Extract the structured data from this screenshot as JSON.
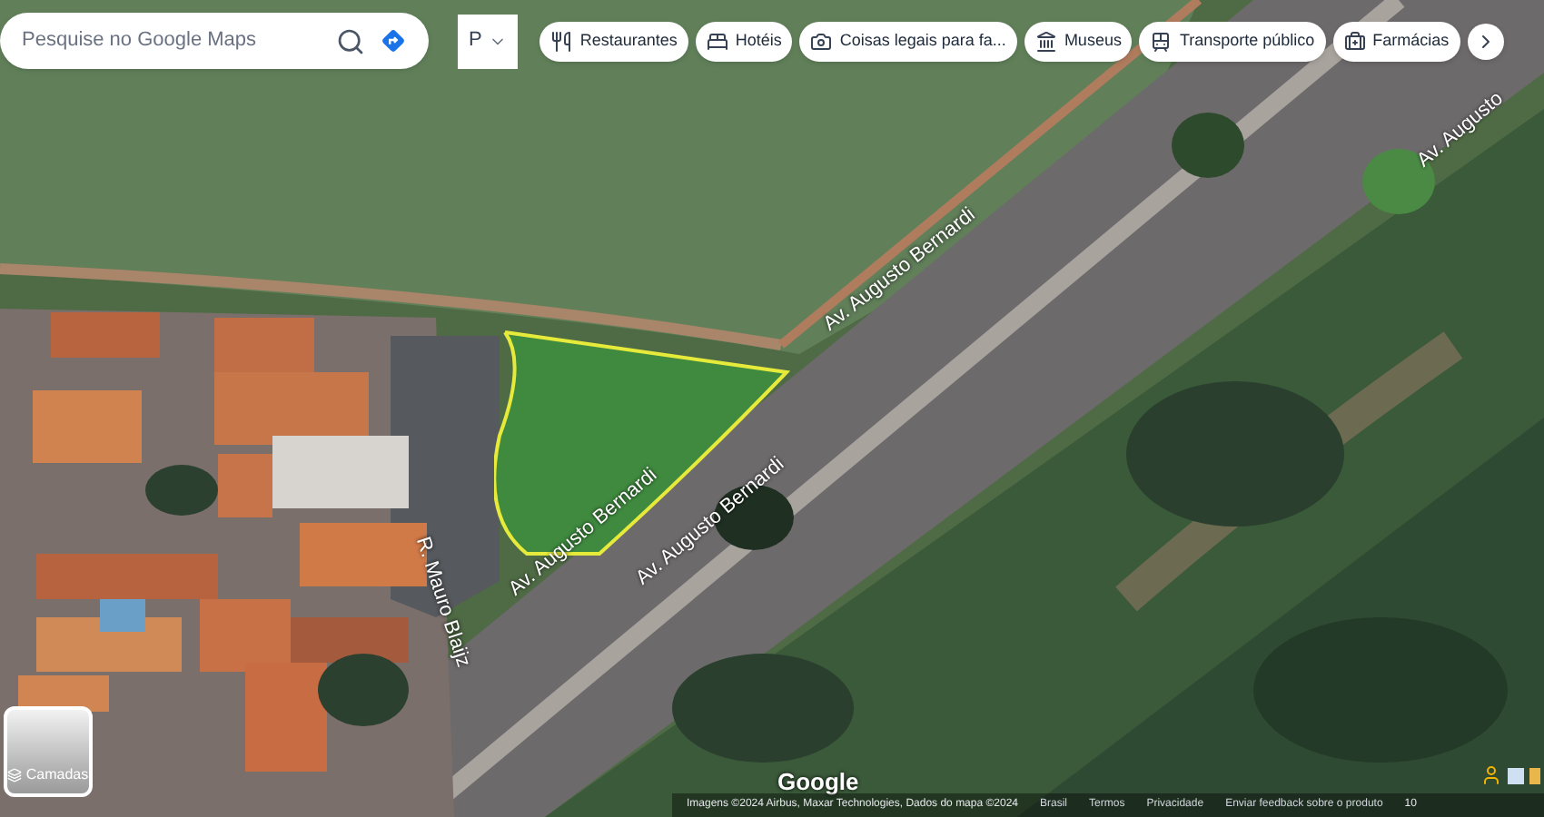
{
  "search": {
    "placeholder": "Pesquise no Google Maps"
  },
  "layer_dropdown": {
    "label": "P"
  },
  "chips": [
    {
      "label": "Restaurantes",
      "kind": "restaurant"
    },
    {
      "label": "Hotéis",
      "kind": "hotel"
    },
    {
      "label": "Coisas legais para fa...",
      "kind": "camera"
    },
    {
      "label": "Museus",
      "kind": "museum"
    },
    {
      "label": "Transporte público",
      "kind": "transit"
    },
    {
      "label": "Farmácias",
      "kind": "pharmacy"
    }
  ],
  "street_labels": [
    "Av. Augusto Bernardi",
    "Av. Augusto Bernardi",
    "Av. Augusto Bernardi",
    "R. Mauro Blaijz",
    "Av. Augusto"
  ],
  "layers_button": {
    "label": "Camadas"
  },
  "google_logo": "Google",
  "footer": {
    "attribution": "Imagens ©2024 Airbus, Maxar Technologies, Dados do mapa ©2024",
    "links": [
      "Brasil",
      "Termos",
      "Privacidade",
      "Enviar feedback sobre o produto"
    ],
    "scale": "10"
  }
}
